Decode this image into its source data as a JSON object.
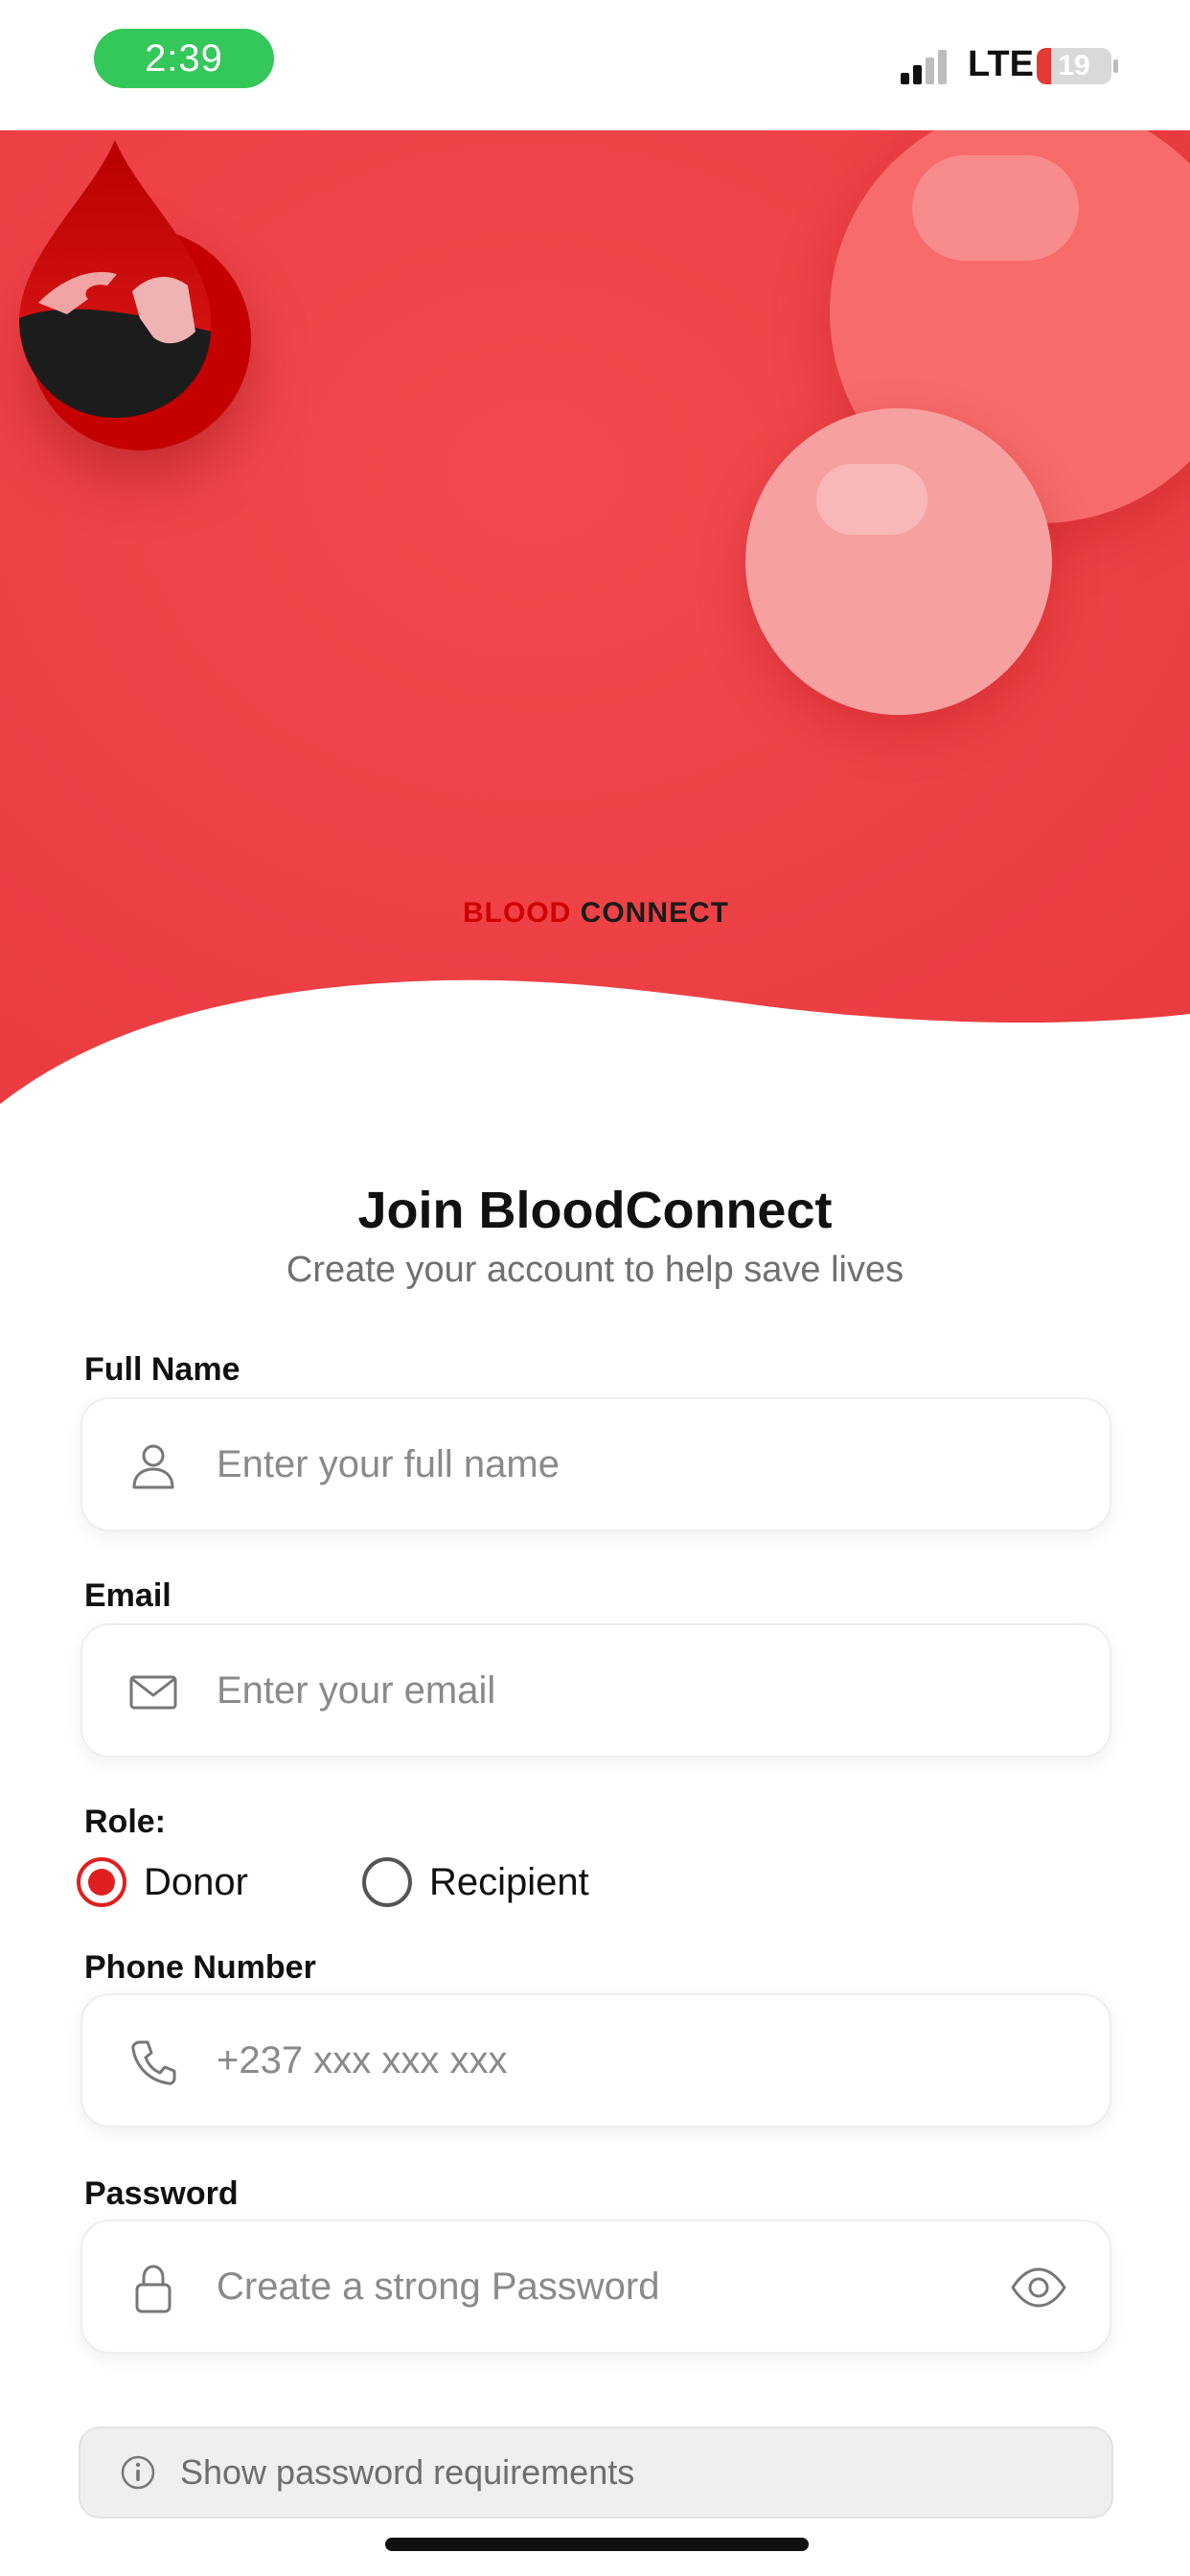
{
  "status_bar": {
    "time": "2:39",
    "network": "LTE",
    "battery": "19",
    "battery_level": 0.19
  },
  "brand": {
    "part1": "BLOOD ",
    "part2": "CONNECT"
  },
  "colors": {
    "accent": "#e02020",
    "hero": "#f0454a",
    "time_pill": "#34c759"
  },
  "header": {
    "title": "Join BloodConnect",
    "subtitle": "Create your account to help save lives"
  },
  "form": {
    "full_name": {
      "label": "Full Name",
      "placeholder": "Enter your full name",
      "icon": "user-icon"
    },
    "email": {
      "label": "Email",
      "placeholder": "Enter your email",
      "icon": "mail-icon"
    },
    "role": {
      "label": "Role:",
      "options": [
        {
          "label": "Donor",
          "selected": true
        },
        {
          "label": "Recipient",
          "selected": false
        }
      ]
    },
    "phone": {
      "label": "Phone Number",
      "placeholder": "+237 xxx xxx xxx",
      "icon": "phone-icon"
    },
    "password": {
      "label": "Password",
      "placeholder": "Create a strong Password",
      "icon": "lock-icon",
      "toggle_icon": "eye-icon"
    },
    "requirements": {
      "label": "Show password requirements",
      "icon": "info-icon"
    }
  }
}
